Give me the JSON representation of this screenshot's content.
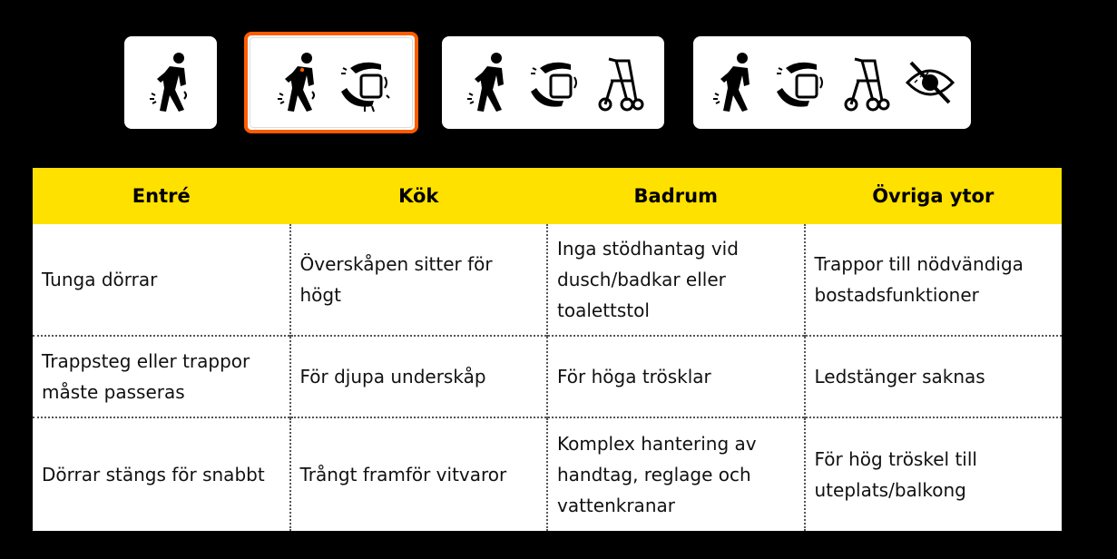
{
  "levels": [
    {
      "icons": [
        "person-pain-icon"
      ],
      "selected": false
    },
    {
      "icons": [
        "person-pain-icon",
        "grip-jar-icon"
      ],
      "selected": true
    },
    {
      "icons": [
        "person-pain-icon",
        "grip-jar-icon",
        "rollator-icon"
      ],
      "selected": false
    },
    {
      "icons": [
        "person-pain-icon",
        "grip-jar-icon",
        "rollator-icon",
        "low-vision-icon"
      ],
      "selected": false
    }
  ],
  "accent_colors": {
    "header": "#ffe100",
    "selected_border": "#ff5b00"
  },
  "table": {
    "headers": [
      "Entré",
      "Kök",
      "Badrum",
      "Övriga ytor"
    ],
    "rows": [
      [
        "Tunga dörrar",
        "Överskåpen sitter för högt",
        "Inga stödhantag vid dusch/badkar eller toalettstol",
        "Trappor till nödvändiga bostadsfunktioner"
      ],
      [
        "Trappsteg eller trappor måste passeras",
        "För djupa underskåp",
        "För höga trösklar",
        "Ledstänger saknas"
      ],
      [
        "Dörrar stängs för snabbt",
        "Trångt framför vitvaror",
        "Komplex hantering av handtag, reglage och vattenkranar",
        "För hög tröskel till uteplats/balkong"
      ]
    ]
  }
}
